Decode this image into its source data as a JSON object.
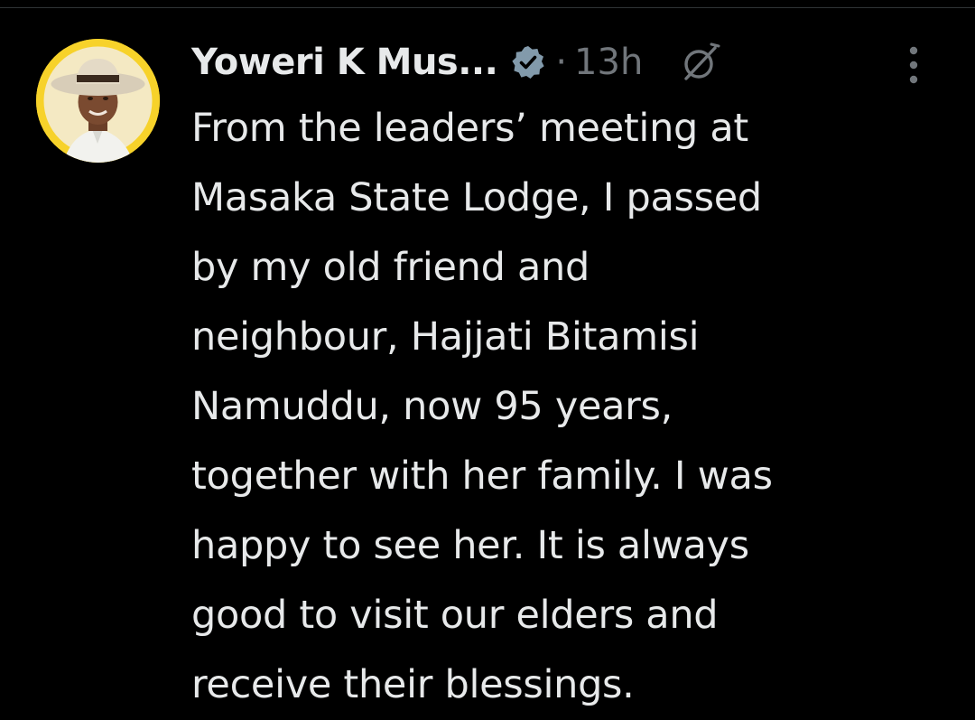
{
  "tweet": {
    "author": {
      "display_name": "Yoweri K Mus...",
      "avatar": "avatar-photo",
      "verified_icon": "verified-badge-icon"
    },
    "separator": "·",
    "time": "13h",
    "grok_icon": "grok-icon",
    "more_icon": "more-vertical-icon",
    "text": "From the leaders’ meeting at\nMasaka State Lodge, I passed\nby my old friend and\nneighbour, Hajjati Bitamisi\nNamuddu, now 95 years,\ntogether with her family. I was\nhappy to see her. It is always\ngood to visit our elders and\nreceive their blessings."
  },
  "colors": {
    "background": "#000000",
    "text_primary": "#e7e9ea",
    "text_secondary": "#71767b",
    "verified_badge": "#829aab",
    "avatar_ring": "#f7d22a",
    "divider": "#2f3336"
  }
}
